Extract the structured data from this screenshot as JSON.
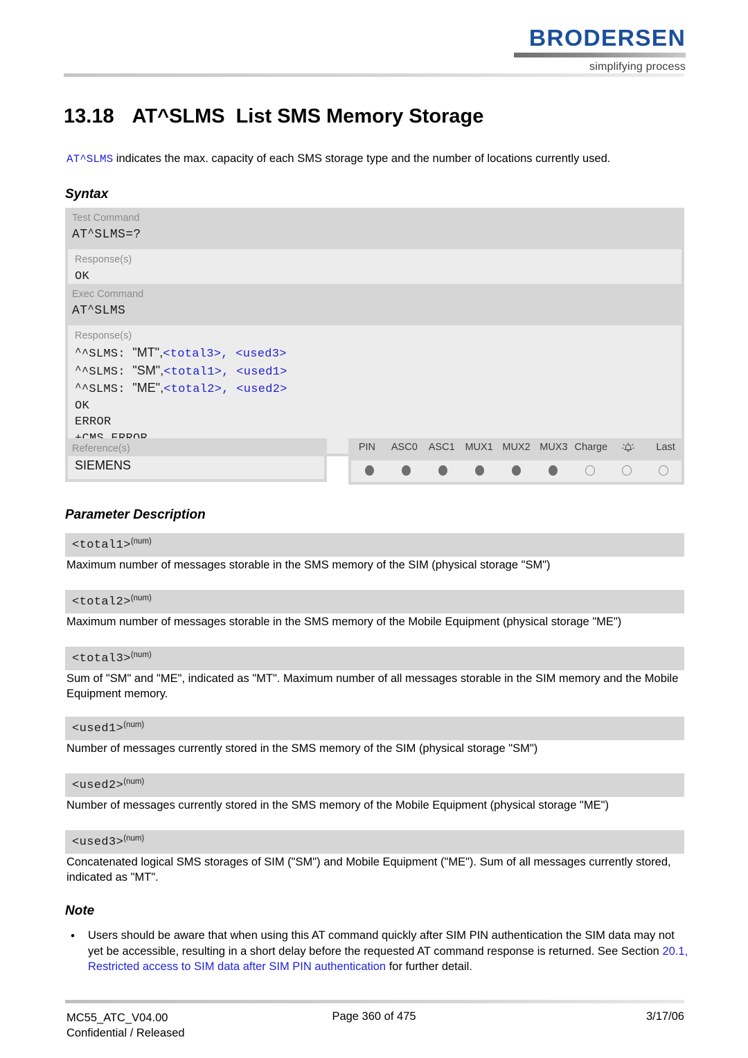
{
  "header": {
    "logo_word": "BRODERSEN",
    "logo_tagline": "simplifying process"
  },
  "title": {
    "number": "13.18",
    "command": "AT^SLMS",
    "text": "List SMS Memory Storage"
  },
  "intro": {
    "command": "AT^SLMS",
    "rest": " indicates the max. capacity of each SMS storage type and the number of locations currently used."
  },
  "sections": {
    "syntax": "Syntax",
    "parameter_description": "Parameter Description",
    "note": "Note"
  },
  "syntax": {
    "test": {
      "label": "Test Command",
      "command": "AT^SLMS=?",
      "response_label": "Response(s)",
      "responses": [
        "OK"
      ]
    },
    "exec": {
      "label": "Exec Command",
      "command": "AT^SLMS",
      "response_label": "Response(s)",
      "response_lines": [
        {
          "prefix": "^SLMS: ",
          "quoted": "\"MT\",",
          "params": "<total3>, <used3>"
        },
        {
          "prefix": "^SLMS: ",
          "quoted": "\"SM\",",
          "params": "<total1>, <used1>"
        },
        {
          "prefix": "^SLMS: ",
          "quoted": "\"ME\",",
          "params": "<total2>, <used2>"
        }
      ],
      "plain_responses": [
        "OK",
        "ERROR",
        "+CMS ERROR"
      ]
    },
    "reference": {
      "label": "Reference(s)",
      "value": "SIEMENS"
    },
    "capabilities": {
      "columns": [
        "PIN",
        "ASC0",
        "ASC1",
        "MUX1",
        "MUX2",
        "MUX3",
        "Charge",
        "alarm-bell-icon",
        "Last"
      ],
      "states": [
        "filled",
        "filled",
        "filled",
        "filled",
        "filled",
        "filled",
        "open",
        "open",
        "open"
      ]
    }
  },
  "parameters": [
    {
      "name": "<total1>",
      "type": "(num)",
      "description": "Maximum number of messages storable in the SMS memory of the SIM (physical storage \"SM\")"
    },
    {
      "name": "<total2>",
      "type": "(num)",
      "description": "Maximum number of messages storable in the SMS memory of the Mobile Equipment (physical storage \"ME\")"
    },
    {
      "name": "<total3>",
      "type": "(num)",
      "description": "Sum of \"SM\" and \"ME\", indicated as \"MT\". Maximum number of all messages storable in the SIM memory and the Mobile Equipment memory."
    },
    {
      "name": "<used1>",
      "type": "(num)",
      "description": "Number of messages currently stored in the SMS memory of the SIM (physical storage \"SM\")"
    },
    {
      "name": "<used2>",
      "type": "(num)",
      "description": "Number of messages currently stored in the SMS memory of the Mobile Equipment (physical storage \"ME\")"
    },
    {
      "name": "<used3>",
      "type": "(num)",
      "description": "Concatenated logical SMS storages of SIM (\"SM\") and Mobile Equipment (\"ME\"). Sum of all messages currently stored, indicated as \"MT\"."
    }
  ],
  "note": {
    "bullet": "•",
    "part1": "Users should be aware that when using this AT command quickly after SIM PIN authentication the SIM data may not yet be accessible, resulting in a short delay before the requested AT command response is returned. See Section ",
    "link": "20.1, Restricted access to SIM data after SIM PIN authentication",
    "part2": " for further detail."
  },
  "footer": {
    "doc_id": "MC55_ATC_V04.00",
    "classification": "Confidential / Released",
    "page": "Page 360 of 475",
    "date": "3/17/06"
  },
  "colors": {
    "logo_blue": "#1b4f9c",
    "link_blue": "#2222dd",
    "param_blue": "#2222cc",
    "block_grey": "#d6d6d6",
    "block_light": "#ececec"
  }
}
